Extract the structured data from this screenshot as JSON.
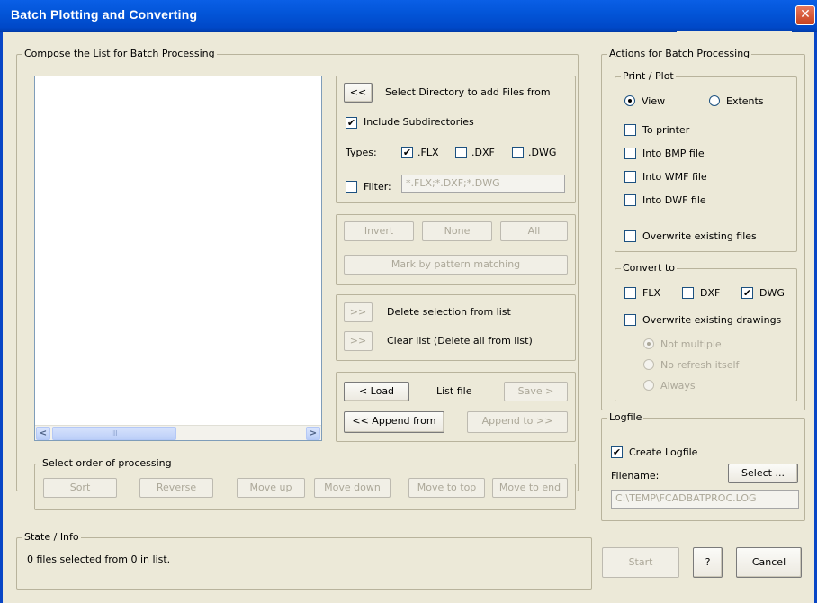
{
  "window": {
    "title": "Batch Plotting and Converting",
    "close_glyph": "✕"
  },
  "compose": {
    "legend": "Compose the List for Batch Processing",
    "scroll_left": "<",
    "scroll_right": ">",
    "scroll_thumb": "III",
    "select_dir_button": "<<",
    "select_dir_label": "Select Directory to add Files from",
    "include_subdirs_label": "Include Subdirectories",
    "include_subdirs_checked": true,
    "types_label": "Types:",
    "type_flx": ".FLX",
    "type_dxf": ".DXF",
    "type_dwg": ".DWG",
    "filter_label": "Filter:",
    "filter_value": "*.FLX;*.DXF;*.DWG",
    "invert_button": "Invert",
    "none_button": "None",
    "all_button": "All",
    "mark_pattern_button": "Mark by pattern matching",
    "delete_sel_button": ">>",
    "delete_sel_label": "Delete selection from list",
    "clear_list_button": ">>",
    "clear_list_label": "Clear list (Delete all from list)",
    "load_button": "< Load",
    "list_file_label": "List file",
    "save_button": "Save >",
    "append_from_button": "<< Append from",
    "append_to_button": "Append to >>"
  },
  "order": {
    "legend": "Select order of processing",
    "sort": "Sort",
    "reverse": "Reverse",
    "move_up": "Move up",
    "move_down": "Move down",
    "move_to_top": "Move to top",
    "move_to_end": "Move to end"
  },
  "actions": {
    "legend": "Actions for Batch Processing",
    "print_legend": "Print / Plot",
    "view_label": "View",
    "extents_label": "Extents",
    "to_printer": "To printer",
    "into_bmp": "Into BMP file",
    "into_wmf": "Into WMF file",
    "into_dwf": "Into DWF file",
    "overwrite_files": "Overwrite existing files",
    "convert_legend": "Convert to",
    "flx": "FLX",
    "dxf": "DXF",
    "dwg": "DWG",
    "overwrite_drawings": "Overwrite existing drawings",
    "not_multiple": "Not multiple",
    "no_refresh": "No refresh itself",
    "always": "Always"
  },
  "logfile": {
    "legend": "Logfile",
    "create_label": "Create Logfile",
    "filename_label": "Filename:",
    "select_button": "Select ...",
    "path": "C:\\TEMP\\FCADBATPROC.LOG"
  },
  "state": {
    "legend": "State / Info",
    "message": "0 files selected from 0 in list."
  },
  "footer": {
    "start": "Start",
    "help": "?",
    "cancel": "Cancel"
  },
  "check_glyph": "✔"
}
